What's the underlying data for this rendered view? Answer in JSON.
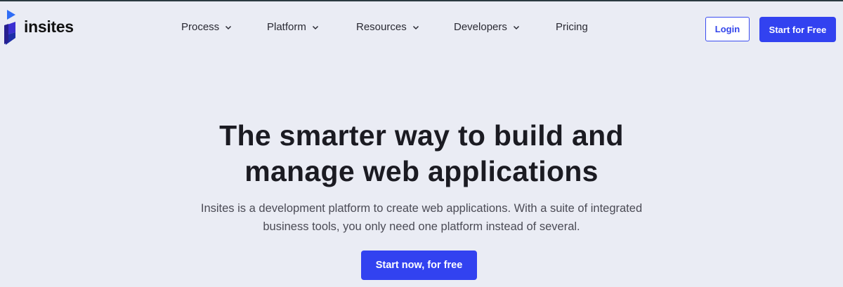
{
  "header": {
    "logo_text": "insites",
    "nav": [
      {
        "label": "Process",
        "has_dropdown": true
      },
      {
        "label": "Platform",
        "has_dropdown": true
      },
      {
        "label": "Resources",
        "has_dropdown": true
      },
      {
        "label": "Developers",
        "has_dropdown": true
      },
      {
        "label": "Pricing",
        "has_dropdown": false
      }
    ],
    "login_label": "Login",
    "start_label": "Start for Free"
  },
  "hero": {
    "title_line1": "The smarter way to build and",
    "title_line2": "manage web applications",
    "subtitle_line1": "Insites is a development platform to create web applications. With a suite of integrated",
    "subtitle_line2": "business tools, you only need one platform instead of several.",
    "cta_label": "Start now, for free"
  },
  "colors": {
    "accent": "#3242f0",
    "background": "#eaecf4",
    "text": "#1b1b22"
  }
}
